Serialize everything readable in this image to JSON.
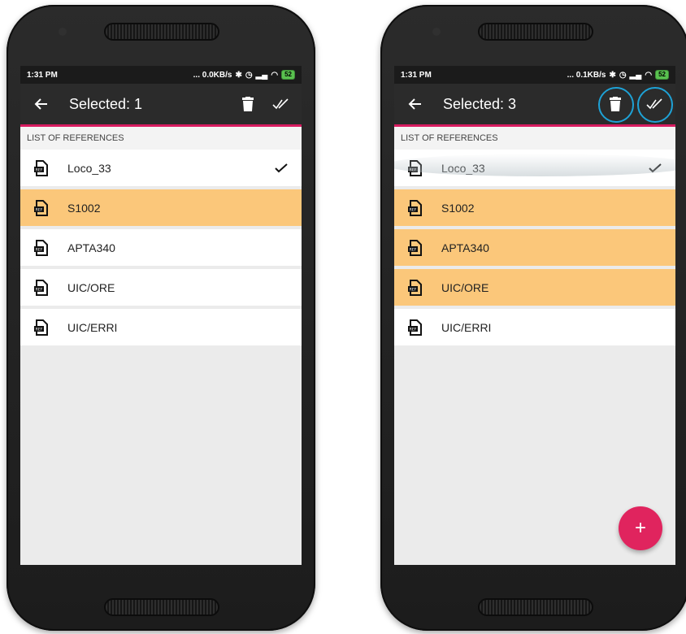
{
  "left_phone": {
    "status": {
      "time": "1:31 PM",
      "network": "... 0.0KB/s",
      "battery": "52"
    },
    "appbar": {
      "title": "Selected: 1"
    },
    "section_header": "LIST OF REFERENCES",
    "items": [
      {
        "label": "Loco_33",
        "selected": false,
        "checked": true
      },
      {
        "label": "S1002",
        "selected": true,
        "checked": false
      },
      {
        "label": "APTA340",
        "selected": false,
        "checked": false
      },
      {
        "label": "UIC/ORE",
        "selected": false,
        "checked": false
      },
      {
        "label": "UIC/ERRI",
        "selected": false,
        "checked": false
      }
    ]
  },
  "right_phone": {
    "status": {
      "time": "1:31 PM",
      "network": "... 0.1KB/s",
      "battery": "52"
    },
    "appbar": {
      "title": "Selected: 3"
    },
    "section_header": "LIST OF REFERENCES",
    "items": [
      {
        "label": "Loco_33",
        "selected": false,
        "checked": true
      },
      {
        "label": "S1002",
        "selected": true,
        "checked": false
      },
      {
        "label": "APTA340",
        "selected": true,
        "checked": false
      },
      {
        "label": "UIC/ORE",
        "selected": true,
        "checked": false
      },
      {
        "label": "UIC/ERRI",
        "selected": false,
        "checked": false
      }
    ],
    "fab_label": "+"
  },
  "icons": {
    "back": "arrow-back-icon",
    "delete": "trash-icon",
    "select_all": "double-check-icon",
    "reference": "ref-file-icon",
    "check": "check-icon"
  },
  "colors": {
    "selected_row": "#fbc77a",
    "accent": "#d81b60",
    "fab": "#e0245e",
    "highlight_ring": "#1ea2d6",
    "appbar": "#2b2b2b"
  }
}
